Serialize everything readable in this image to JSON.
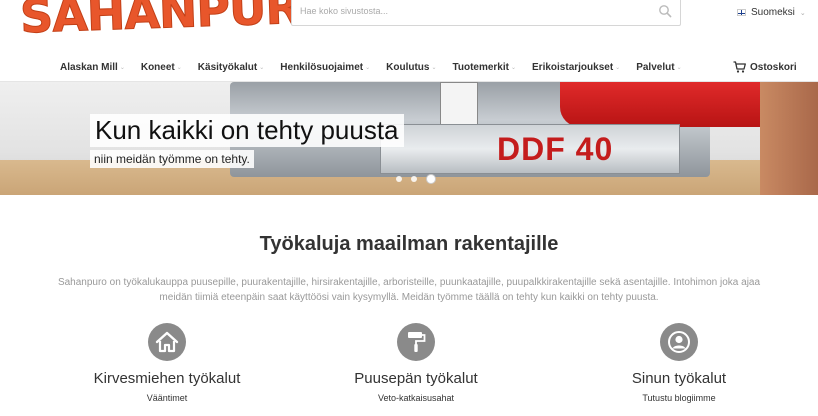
{
  "header": {
    "logo_text": "SAHANPURO",
    "search_placeholder": "Hae koko sivustosta...",
    "language": "Suomeksi"
  },
  "nav": {
    "items": [
      {
        "label": "Alaskan Mill"
      },
      {
        "label": "Koneet"
      },
      {
        "label": "Käsityökalut"
      },
      {
        "label": "Henkilösuojaimet"
      },
      {
        "label": "Koulutus"
      },
      {
        "label": "Tuotemerkit"
      },
      {
        "label": "Erikoistarjoukset"
      },
      {
        "label": "Palvelut"
      }
    ],
    "cart_label": "Ostoskori"
  },
  "hero": {
    "title": "Kun kaikki on tehty puusta",
    "subtitle": "niin meidän työmme on tehty.",
    "model_label": "DDF 40",
    "slides": 3,
    "active_slide": 3
  },
  "content": {
    "title": "Työkaluja maailman rakentajille",
    "intro": "Sahanpuro on työkalukauppa puusepille, puurakentajille, hirsirakentajille, arboristeille, puunkaatajille, puupalkkirakentajille sekä asentajille. Intohimon joka ajaa meidän tiimiä eteenpäin saat käyttöösi vain kysymyllä. Meidän työmme täällä on tehty kun kaikki on tehty puusta.",
    "features": [
      {
        "title": "Kirvesmiehen työkalut",
        "link": "Vääntimet",
        "icon": "house-icon"
      },
      {
        "title": "Puusepän työkalut",
        "link": "Veto-katkaisusahat",
        "icon": "paint-roller-icon"
      },
      {
        "title": "Sinun työkalut",
        "link": "Tutustu blogiimme",
        "icon": "user-icon"
      }
    ]
  },
  "colors": {
    "brand": "#e8562b",
    "accent_red": "#c41c1c",
    "icon_gray": "#8a8a8a"
  }
}
